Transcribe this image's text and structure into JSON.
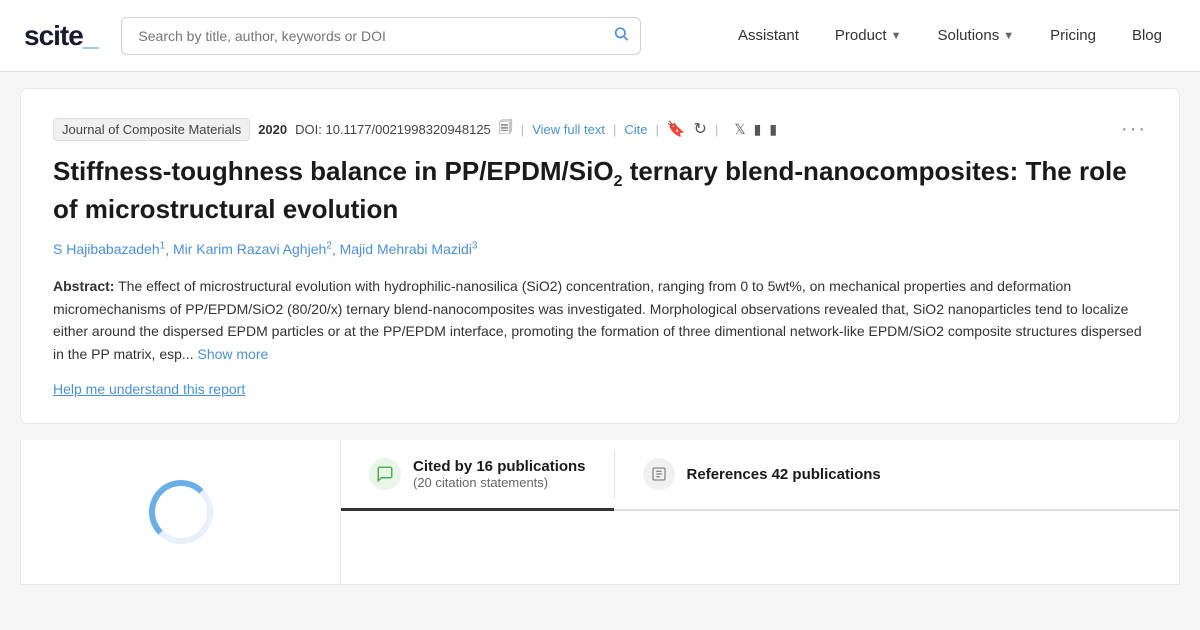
{
  "navbar": {
    "logo_text": "scite_",
    "search_placeholder": "Search by title, author, keywords or DOI",
    "nav_items": [
      {
        "label": "Assistant",
        "has_chevron": false
      },
      {
        "label": "Product",
        "has_chevron": true
      },
      {
        "label": "Solutions",
        "has_chevron": true
      },
      {
        "label": "Pricing",
        "has_chevron": false
      },
      {
        "label": "Blog",
        "has_chevron": false
      }
    ]
  },
  "paper": {
    "journal": "Journal of Composite Materials",
    "year": "2020",
    "doi_label": "DOI:",
    "doi_value": "10.1177/0021998320948125",
    "view_full_text": "View full text",
    "cite": "Cite",
    "title_line1": "Stiffness-toughness balance in PP/EPDM/SiO",
    "title_sub": "2",
    "title_line2": " ternary blend-nanocomposites: The role of microstructural evolution",
    "authors": [
      {
        "name": "S Hajibabazadeh",
        "sup": "1"
      },
      {
        "name": "Mir Karim Razavi Aghjeh",
        "sup": "2"
      },
      {
        "name": "Majid Mehrabi Mazidi",
        "sup": "3"
      }
    ],
    "abstract_label": "Abstract:",
    "abstract_text": "The effect of microstructural evolution with hydrophilic-nanosilica (SiO2) concentration, ranging from 0 to 5wt%, on mechanical properties and deformation micromechanisms of PP/EPDM/SiO2 (80/20/x) ternary blend-nanocomposites was investigated. Morphological observations revealed that, SiO2 nanoparticles tend to localize either around the dispersed EPDM particles or at the PP/EPDM interface, promoting the formation of three dimentional network-like EPDM/SiO2 composite structures dispersed in the PP matrix, esp...",
    "show_more": "Show more",
    "help_link": "Help me understand this report"
  },
  "tabs": {
    "cited_by_label": "Cited by 16 publications",
    "cited_by_sub": "(20 citation statements)",
    "references_label": "References 42 publications"
  }
}
